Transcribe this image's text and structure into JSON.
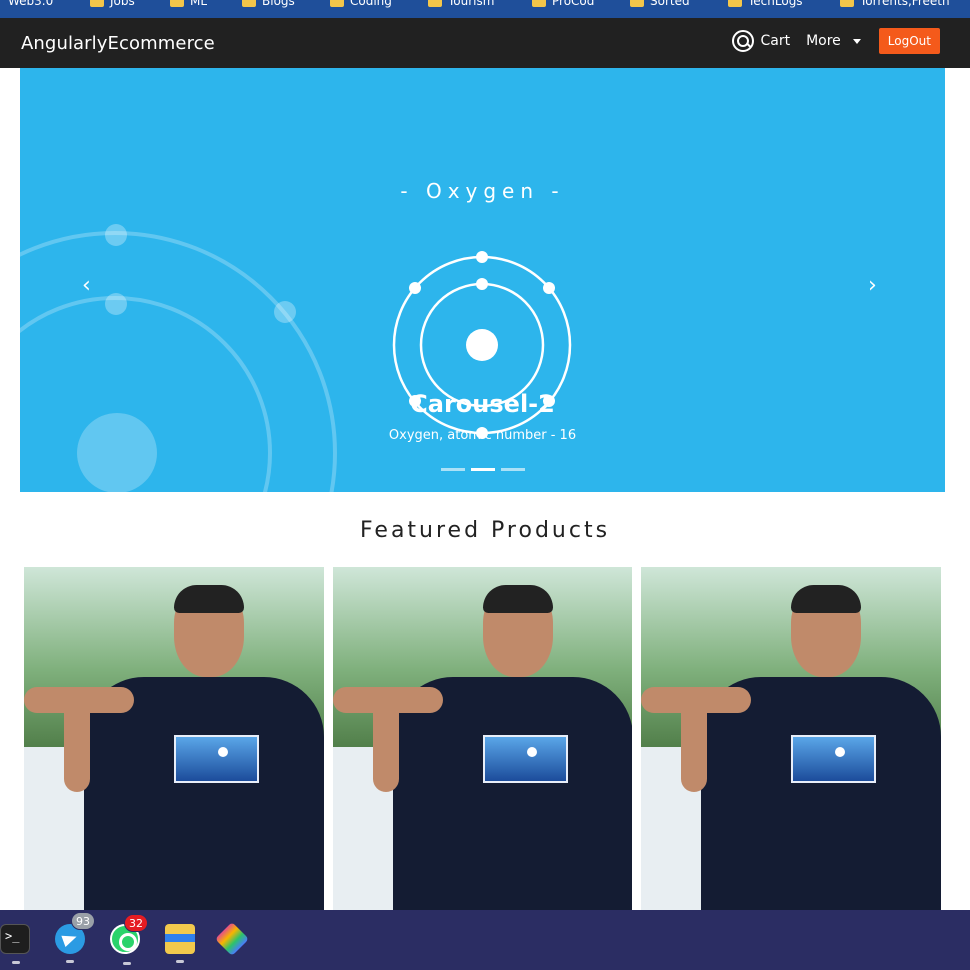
{
  "bookmarks": [
    "Web3.0",
    "Jobs",
    "ML",
    "Blogs",
    "Coding",
    "Tourism",
    "ProCod",
    "Sorted",
    "TechLogs",
    "Torrents,Freeth"
  ],
  "navbar": {
    "brand": "AngularlyEcommerce",
    "cart_label": "Cart",
    "more_label": "More",
    "logout_label": "LogOut",
    "colors": {
      "background": "#212121",
      "logout": "#f45a1b"
    }
  },
  "carousel": {
    "bg_color": "#2db5ec",
    "image_text": "- Oxygen -",
    "caption_title": "Carousel-2",
    "caption_subtitle": "Oxygen, atomic number - 16",
    "indicator_count": 3,
    "active_index": 1,
    "prev_icon": "chevron-left-icon",
    "next_icon": "chevron-right-icon"
  },
  "featured": {
    "title": "Featured Products",
    "product_count": 3
  },
  "taskbar": {
    "items": [
      {
        "name": "terminal-icon"
      },
      {
        "name": "telegram-icon",
        "badge": "93"
      },
      {
        "name": "whatsapp-icon",
        "badge": "32"
      },
      {
        "name": "file-manager-icon"
      },
      {
        "name": "git-icon"
      }
    ]
  }
}
